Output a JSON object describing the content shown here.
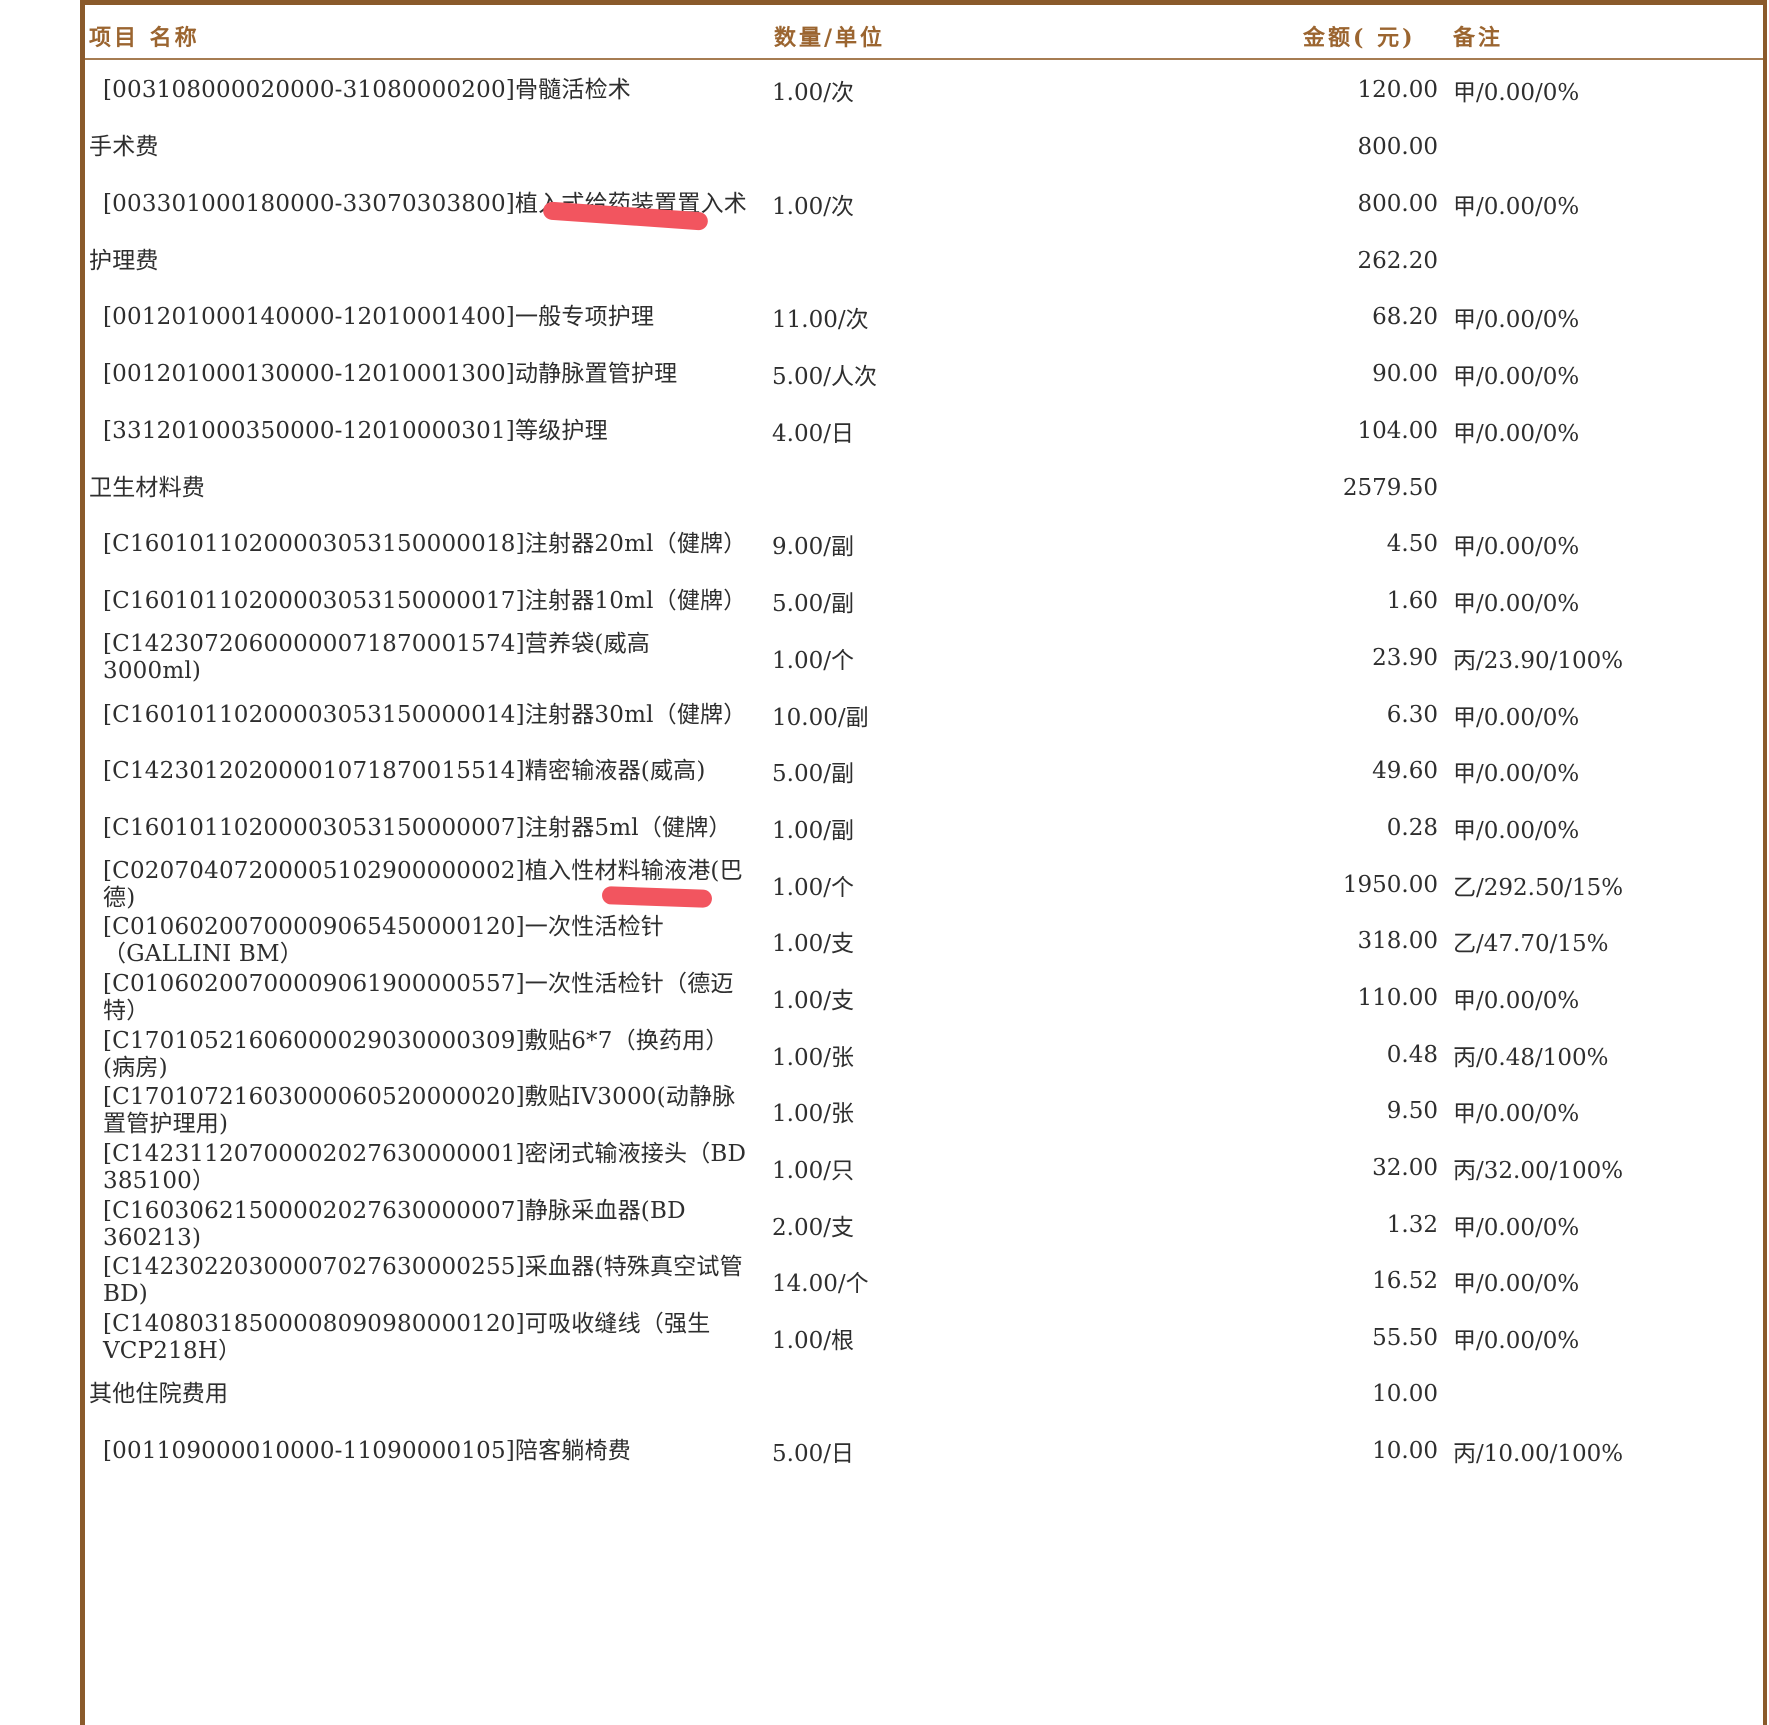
{
  "header": {
    "col_name": "项目 名称",
    "col_qty": "数量/单位",
    "col_amount": "金额( 元)",
    "col_note": "备注"
  },
  "rows": [
    {
      "type": "item",
      "name": "[003108000020000-31080000200]骨髓活检术",
      "qty": "1.00/次",
      "amount": "120.00",
      "note": "甲/0.00/0%"
    },
    {
      "type": "category",
      "name": "手术费",
      "qty": "",
      "amount": "800.00",
      "note": ""
    },
    {
      "type": "item",
      "name": "[003301000180000-33070303800]植入式给药装置置入术",
      "qty": "1.00/次",
      "amount": "800.00",
      "note": "甲/0.00/0%"
    },
    {
      "type": "category",
      "name": "护理费",
      "qty": "",
      "amount": "262.20",
      "note": ""
    },
    {
      "type": "item",
      "name": "[001201000140000-12010001400]一般专项护理",
      "qty": "11.00/次",
      "amount": "68.20",
      "note": "甲/0.00/0%"
    },
    {
      "type": "item",
      "name": "[001201000130000-12010001300]动静脉置管护理",
      "qty": "5.00/人次",
      "amount": "90.00",
      "note": "甲/0.00/0%"
    },
    {
      "type": "item",
      "name": "[331201000350000-12010000301]等级护理",
      "qty": "4.00/日",
      "amount": "104.00",
      "note": "甲/0.00/0%"
    },
    {
      "type": "category",
      "name": "卫生材料费",
      "qty": "",
      "amount": "2579.50",
      "note": ""
    },
    {
      "type": "item",
      "name": "[C16010110200003053150000018]注射器20ml（健牌）",
      "qty": "9.00/副",
      "amount": "4.50",
      "note": "甲/0.00/0%"
    },
    {
      "type": "item",
      "name": "[C16010110200003053150000017]注射器10ml（健牌）",
      "qty": "5.00/副",
      "amount": "1.60",
      "note": "甲/0.00/0%"
    },
    {
      "type": "item",
      "name": "[C14230720600000071870001574]营养袋(威高 3000ml)",
      "qty": "1.00/个",
      "amount": "23.90",
      "note": "丙/23.90/100%"
    },
    {
      "type": "item",
      "name": "[C16010110200003053150000014]注射器30ml（健牌）",
      "qty": "10.00/副",
      "amount": "6.30",
      "note": "甲/0.00/0%"
    },
    {
      "type": "item",
      "name": "[C14230120200001071870015514]精密输液器(威高)",
      "qty": "5.00/副",
      "amount": "49.60",
      "note": "甲/0.00/0%"
    },
    {
      "type": "item",
      "name": "[C16010110200003053150000007]注射器5ml（健牌）",
      "qty": "1.00/副",
      "amount": "0.28",
      "note": "甲/0.00/0%"
    },
    {
      "type": "item",
      "name": "[C02070407200005102900000002]植入性材料输液港(巴德)",
      "qty": "1.00/个",
      "amount": "1950.00",
      "note": "乙/292.50/15%"
    },
    {
      "type": "item",
      "name": "[C01060200700009065450000120]一次性活检针（GALLINI BM）",
      "qty": "1.00/支",
      "amount": "318.00",
      "note": "乙/47.70/15%"
    },
    {
      "type": "item",
      "name": "[C01060200700009061900000557]一次性活检针（德迈特）",
      "qty": "1.00/支",
      "amount": "110.00",
      "note": "甲/0.00/0%"
    },
    {
      "type": "item",
      "name": "[C17010521606000029030000309]敷贴6*7（换药用）(病房)",
      "qty": "1.00/张",
      "amount": "0.48",
      "note": "丙/0.48/100%"
    },
    {
      "type": "item",
      "name": "[C17010721603000060520000020]敷贴IV3000(动静脉置管护理用)",
      "qty": "1.00/张",
      "amount": "9.50",
      "note": "甲/0.00/0%"
    },
    {
      "type": "item",
      "name": "[C14231120700002027630000001]密闭式输液接头（BD 385100）",
      "qty": "1.00/只",
      "amount": "32.00",
      "note": "丙/32.00/100%"
    },
    {
      "type": "item",
      "name": "[C16030621500002027630000007]静脉采血器(BD 360213)",
      "qty": "2.00/支",
      "amount": "1.32",
      "note": "甲/0.00/0%"
    },
    {
      "type": "item",
      "name": "[C14230220300007027630000255]采血器(特殊真空试管BD)",
      "qty": "14.00/个",
      "amount": "16.52",
      "note": "甲/0.00/0%"
    },
    {
      "type": "item",
      "name": "[C14080318500008090980000120]可吸收缝线（强生VCP218H）",
      "qty": "1.00/根",
      "amount": "55.50",
      "note": "甲/0.00/0%"
    },
    {
      "type": "category",
      "name": "其他住院费用",
      "qty": "",
      "amount": "10.00",
      "note": ""
    },
    {
      "type": "item",
      "name": "[001109000010000-11090000105]陪客躺椅费",
      "qty": "5.00/日",
      "amount": "10.00",
      "note": "丙/10.00/100%"
    }
  ]
}
